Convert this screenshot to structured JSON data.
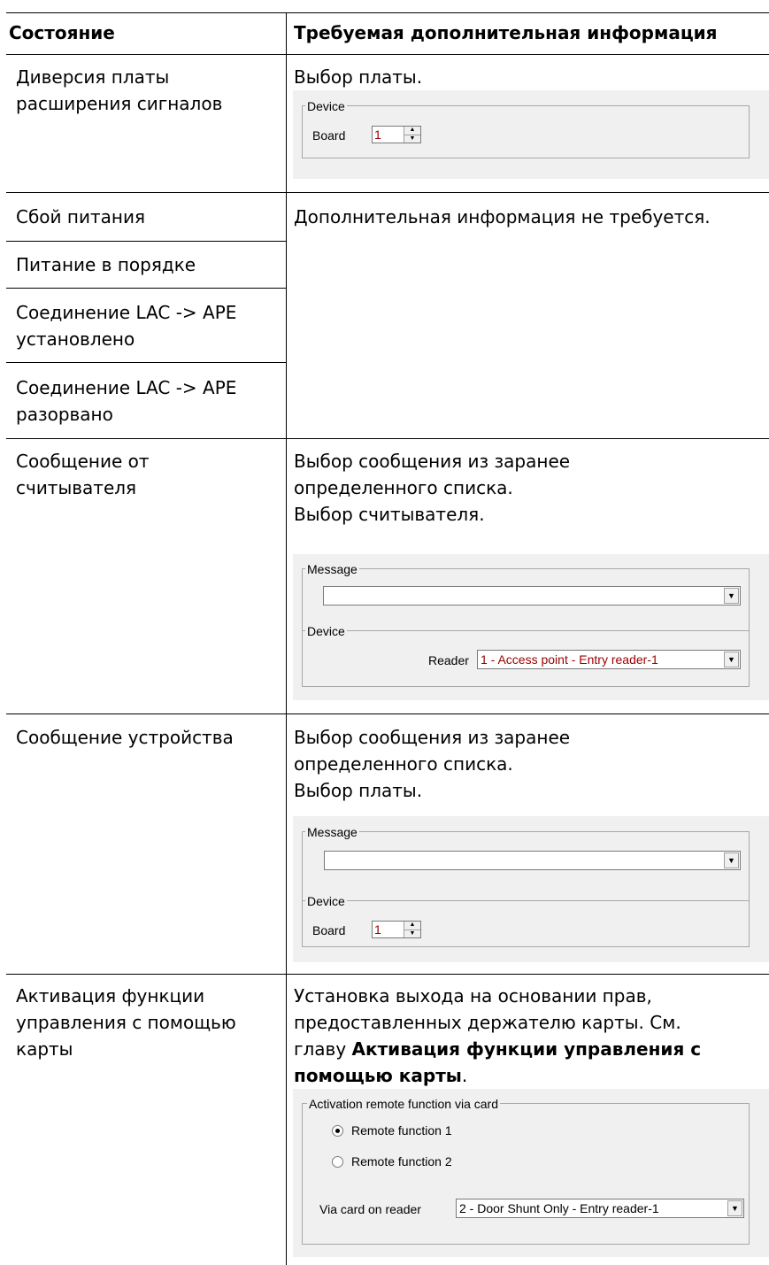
{
  "table": {
    "headers": {
      "state": "Состояние",
      "info": "Требуемая дополнительная информация"
    },
    "rows": [
      {
        "state": [
          "Диверсия платы",
          "расширения сигналов"
        ],
        "info": [
          "Выбор платы."
        ]
      },
      {
        "state": [
          "Сбой питания"
        ],
        "info": [
          "Дополнительная информация не требуется."
        ]
      },
      {
        "state": [
          "Питание в порядке"
        ]
      },
      {
        "state": [
          "Соединение LAC -> APE",
          "установлено"
        ]
      },
      {
        "state": [
          "Соединение LAC -> APE",
          "разорвано"
        ]
      },
      {
        "state": [
          "Сообщение от",
          "считывателя"
        ],
        "info": [
          "Выбор сообщения из заранее",
          "определенного списка.",
          "Выбор считывателя."
        ]
      },
      {
        "state": [
          "Сообщение устройства"
        ],
        "info": [
          "Выбор сообщения из заранее",
          "определенного списка.",
          "Выбор платы."
        ]
      },
      {
        "state": [
          "Активация функции",
          "управления с помощью",
          "карты"
        ],
        "info": [
          "Установка выхода на основании прав,",
          "предоставленных держателю карты. См.",
          "главу "
        ],
        "info_bold": [
          "Активация функции управления с",
          "помощью карты"
        ],
        "info_tail": "."
      }
    ]
  },
  "dialogs": {
    "board_select": {
      "group_device": "Device",
      "board_label": "Board",
      "board_value": "1"
    },
    "reader_message": {
      "group_message": "Message",
      "message_value": "",
      "group_device": "Device",
      "reader_label": "Reader",
      "reader_value": "1 - Access point - Entry reader-1"
    },
    "device_message": {
      "group_message": "Message",
      "message_value": "",
      "group_device": "Device",
      "board_label": "Board",
      "board_value": "1"
    },
    "card_function": {
      "group_title": "Activation remote function via card",
      "options": [
        {
          "label": "Remote function  1",
          "selected": true
        },
        {
          "label": "Remote function 2",
          "selected": false
        }
      ],
      "via_label": "Via card on reader",
      "via_value": "2 - Door Shunt Only - Entry reader-1"
    }
  },
  "colors": {
    "panel_bg": "#f0f0f0",
    "rule": "#000000",
    "value_red": "#990000"
  }
}
